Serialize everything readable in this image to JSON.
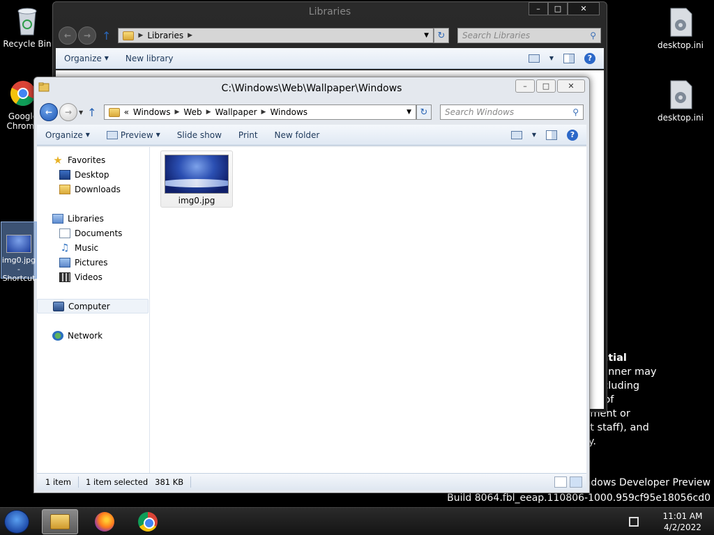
{
  "desktop": {
    "icons": {
      "recycle_bin": "Recycle Bin",
      "chrome": "Google Chrome",
      "desktop_ini_1": "desktop.ini",
      "desktop_ini_2": "desktop.ini",
      "shortcut": "img0.jpg - Shortcut"
    },
    "watermark": {
      "line1": "Confidential",
      "line2": "in any manner may",
      "line3": "to and including",
      "line4": "the case of",
      "line5": "assignment or",
      "line6": "tingent staff), and",
      "line7": "liability."
    },
    "build_line1": "Windows Developer Preview",
    "build_line2": "Build 8064.fbl_eeap.110806-1000.959cf95e18056cd0"
  },
  "back_window": {
    "title": "Libraries",
    "address": [
      "Libraries"
    ],
    "search_placeholder": "Search Libraries",
    "toolbar": {
      "organize": "Organize",
      "new_library": "New library"
    }
  },
  "front_window": {
    "title": "C:\\Windows\\Web\\Wallpaper\\Windows",
    "address_prefix": "«",
    "address": [
      "Windows",
      "Web",
      "Wallpaper",
      "Windows"
    ],
    "search_placeholder": "Search Windows",
    "toolbar": {
      "organize": "Organize",
      "preview": "Preview",
      "slide_show": "Slide show",
      "print": "Print",
      "new_folder": "New folder"
    },
    "nav": {
      "favorites": "Favorites",
      "desktop": "Desktop",
      "downloads": "Downloads",
      "libraries": "Libraries",
      "documents": "Documents",
      "music": "Music",
      "pictures": "Pictures",
      "videos": "Videos",
      "computer": "Computer",
      "network": "Network"
    },
    "files": [
      {
        "name": "img0.jpg"
      }
    ],
    "status": {
      "count": "1 item",
      "selected": "1 item selected",
      "size": "381 KB"
    }
  },
  "taskbar": {
    "time": "11:01 AM",
    "date": "4/2/2022"
  },
  "colors": {
    "accent": "#2c68c8",
    "desktop_bg": "#000000",
    "toolbar_text": "#1e395b"
  }
}
